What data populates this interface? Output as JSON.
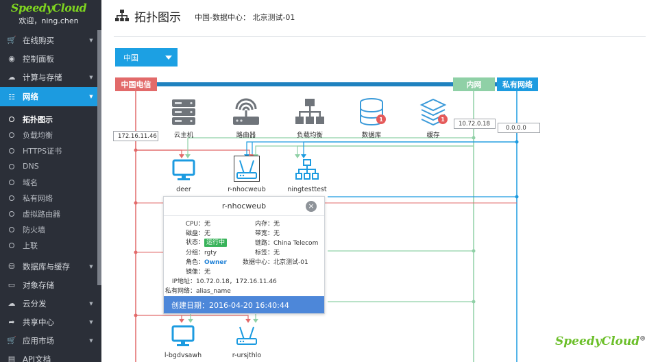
{
  "app": {
    "brand": "SpeedyCloud",
    "welcome": "欢迎，ning.chen",
    "brand_footer": "SpeedyCloud",
    "brand_reg": "®"
  },
  "sidebar": {
    "items": [
      {
        "label": "在线购买",
        "icon": "cart-icon",
        "arrow": true
      },
      {
        "label": "控制面板",
        "icon": "dashboard-icon",
        "arrow": false
      },
      {
        "label": "计算与存储",
        "icon": "cloud-icon",
        "arrow": true
      },
      {
        "label": "网络",
        "icon": "sitemap-icon",
        "arrow": true,
        "active": true
      },
      {
        "label": "数据库与缓存",
        "icon": "database-icon",
        "arrow": true
      },
      {
        "label": "对象存储",
        "icon": "hdd-icon",
        "arrow": false
      },
      {
        "label": "云分发",
        "icon": "cloud-upload-icon",
        "arrow": true
      },
      {
        "label": "共享中心",
        "icon": "share-icon",
        "arrow": true
      },
      {
        "label": "应用市场",
        "icon": "cart-icon",
        "arrow": true
      },
      {
        "label": "API文档",
        "icon": "book-icon",
        "arrow": false
      }
    ],
    "network_sub": [
      "拓扑图示",
      "负载均衡",
      "HTTPS证书",
      "DNS",
      "域名",
      "私有网络",
      "虚拟路由器",
      "防火墙",
      "上联"
    ]
  },
  "page": {
    "title": "拓扑图示",
    "breadcrumb": "中国-数据中心： 北京测试-01",
    "region": "中国"
  },
  "network": {
    "china_telecom": "中国电信",
    "intranet": "内网",
    "private_network": "私有网络",
    "ip_public": "172.16.11.46",
    "ip_intranet": "10.72.0.18",
    "ip_private": "0.0.0.0"
  },
  "services": [
    {
      "label": "云主机",
      "icon": "server-icon"
    },
    {
      "label": "路由器",
      "icon": "router-icon"
    },
    {
      "label": "负载均衡",
      "icon": "load-balancer-icon"
    },
    {
      "label": "数据库",
      "icon": "database-icon",
      "badge": "1"
    },
    {
      "label": "缓存",
      "icon": "cache-icon",
      "badge": "1"
    }
  ],
  "instances": [
    {
      "label": "deer",
      "type": "vm"
    },
    {
      "label": "r-nhocweub",
      "type": "router"
    },
    {
      "label": "ningtesttest",
      "type": "lb"
    },
    {
      "label": "l-bgdvsawh",
      "type": "vm"
    },
    {
      "label": "r-ursjthlo",
      "type": "router"
    }
  ],
  "popup": {
    "title": "r-nhocweub",
    "close": "×",
    "cpu_k": "CPU：",
    "cpu_v": "无",
    "mem_k": "内存：",
    "mem_v": "无",
    "disk_k": "磁盘：",
    "disk_v": "无",
    "bw_k": "带宽：",
    "bw_v": "无",
    "status_k": "状态：",
    "status_v": "运行中",
    "link_k": "链路：",
    "link_v": "China Telecom",
    "group_k": "分组：",
    "group_v": "rgty",
    "tag_k": "标签：",
    "tag_v": "无",
    "role_k": "角色：",
    "role_v": "Owner",
    "dc_k": "数据中心：",
    "dc_v": "北京测试-01",
    "image_k": "镜像：",
    "image_v": "无",
    "ip_k": "IP地址：",
    "ip_v": "10.72.0.18，172.16.11.46",
    "pn_k": "私有网络：",
    "pn_v": "alias_name",
    "created": "创建日期：2016-04-20 16:40:44"
  },
  "colors": {
    "telecom": "#e26a6a",
    "intranet": "#8fd0a6",
    "private": "#1c9be0",
    "accent": "#1ca0e3"
  }
}
